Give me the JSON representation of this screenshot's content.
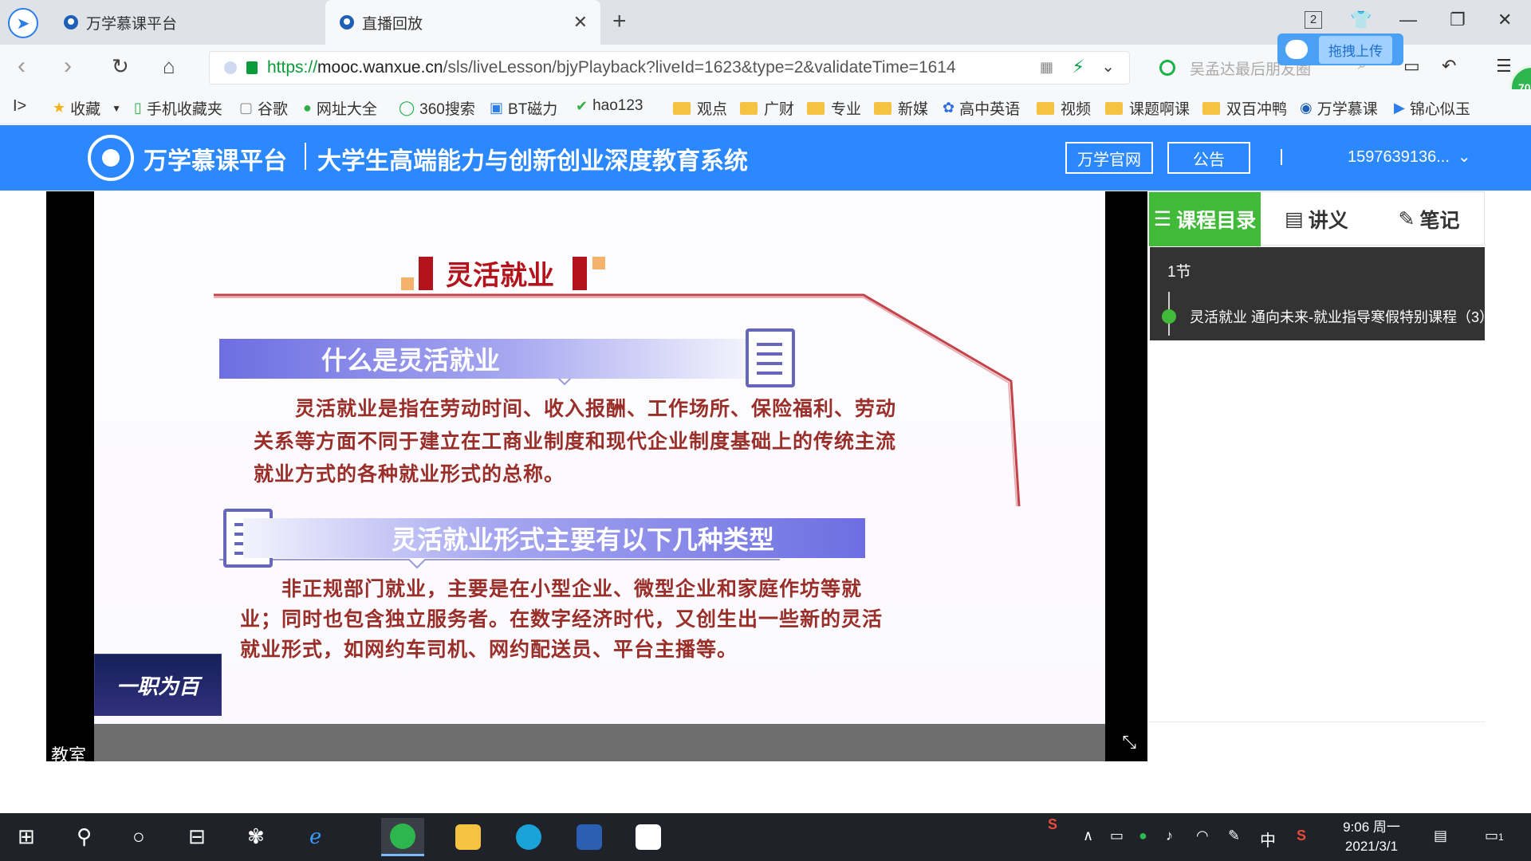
{
  "browser": {
    "tabs": [
      {
        "label": "万学慕课平台"
      },
      {
        "label": "直播回放"
      }
    ],
    "tab_count": "2",
    "url": {
      "protocol": "https://",
      "host": "mooc.wanxue.cn",
      "path": "/sls/liveLesson/bjyPlayback?liveId=1623&type=2&validateTime=1614"
    },
    "search_placeholder": "吴孟达最后朋友圈",
    "upload_popup_label": "拖拽上传",
    "badge": "70"
  },
  "bookmarks": [
    {
      "label": "收藏",
      "icon": "star-icon"
    },
    {
      "label": "手机收藏夹",
      "icon": "phone-icon"
    },
    {
      "label": "谷歌",
      "icon": "page-icon"
    },
    {
      "label": "网址大全",
      "icon": "globe-icon"
    },
    {
      "label": "360搜索",
      "icon": "search-360-icon"
    },
    {
      "label": "BT磁力",
      "icon": "bt-icon"
    },
    {
      "label": "hao123",
      "icon": "hao-icon"
    },
    {
      "label": "观点",
      "icon": "folder-icon"
    },
    {
      "label": "广财",
      "icon": "folder-icon"
    },
    {
      "label": "专业",
      "icon": "folder-icon"
    },
    {
      "label": "新媒",
      "icon": "folder-icon"
    },
    {
      "label": "高中英语",
      "icon": "paw-icon"
    },
    {
      "label": "视频",
      "icon": "folder-icon"
    },
    {
      "label": "课题啊课",
      "icon": "folder-icon"
    },
    {
      "label": "双百冲鸭",
      "icon": "folder-icon"
    },
    {
      "label": "万学慕课",
      "icon": "site-icon"
    },
    {
      "label": "锦心似玉",
      "icon": "play-icon"
    }
  ],
  "site": {
    "brand": "万学慕课平台",
    "subtitle": "大学生高端能力与创新创业深度教育系统",
    "official_btn": "万学官网",
    "notice_btn": "公告",
    "user": "1597639136..."
  },
  "player": {
    "overlay_label": "教室",
    "slide": {
      "title": "灵活就业",
      "section1_heading": "什么是灵活就业",
      "section1_text": "灵活就业是指在劳动时间、收入报酬、工作场所、保险福利、劳动关系等方面不同于建立在工商业制度和现代企业制度基础上的传统主流就业方式的各种就业形式的总称。",
      "section2_heading": "灵活就业形式主要有以下几种类型",
      "section2_text": "非正规部门就业，主要是在小型企业、微型企业和家庭作坊等就业；同时也包含独立服务者。在数字经济时代，又创生出一些新的灵活就业形式，如网约车司机、网约配送员、平台主播等。",
      "tv_logo": "一职为百"
    }
  },
  "sidebar": {
    "tabs": [
      {
        "label": "课程目录",
        "icon": "list-icon"
      },
      {
        "label": "讲义",
        "icon": "doc-icon"
      },
      {
        "label": "笔记",
        "icon": "edit-icon"
      }
    ],
    "section": "1节",
    "lesson": "灵活就业 通向未来-就业指导寒假特别课程（3）"
  },
  "taskbar": {
    "time": "9:06 周一",
    "date": "2021/3/1",
    "ime": "中",
    "notifications": "1"
  },
  "colors": {
    "site_header": "#2b88ff",
    "active_tab": "#41b939",
    "slide_title": "#b3131b",
    "slide_text": "#9a2f2a"
  }
}
